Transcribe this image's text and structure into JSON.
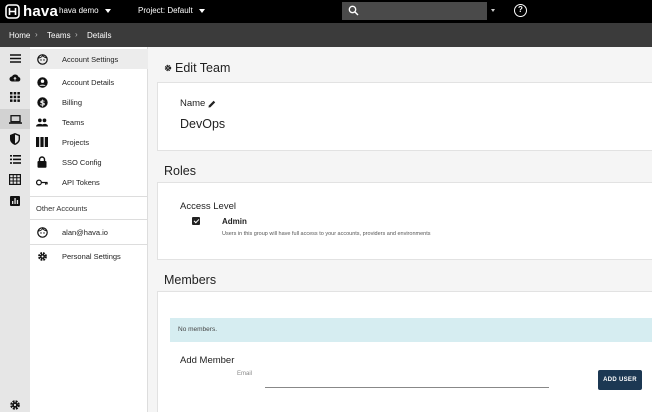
{
  "topbar": {
    "logo_text": "hava",
    "account_label": "hava demo",
    "project_label": "Project: Default",
    "search_placeholder": "",
    "help_glyph": "?"
  },
  "breadcrumb": {
    "items": [
      "Home",
      "Teams",
      "Details"
    ],
    "separator": "›"
  },
  "rail": {
    "icons": [
      "menu-icon",
      "cloud-icon",
      "grid-icon",
      "laptop-icon",
      "shield-icon",
      "list-icon",
      "table-icon",
      "chart-icon",
      "settings-icon"
    ],
    "active": "laptop-icon"
  },
  "sidebar": {
    "header": "Account Settings",
    "items": [
      {
        "label": "Account Details",
        "icon": "user-circle-icon"
      },
      {
        "label": "Billing",
        "icon": "dollar-icon"
      },
      {
        "label": "Teams",
        "icon": "people-icon"
      },
      {
        "label": "Projects",
        "icon": "columns-icon"
      },
      {
        "label": "SSO Config",
        "icon": "lock-icon"
      },
      {
        "label": "API Tokens",
        "icon": "key-icon"
      }
    ],
    "other_accounts_title": "Other Accounts",
    "other_account": "alan@hava.io",
    "personal_settings": "Personal Settings"
  },
  "main": {
    "edit_title": "Edit Team",
    "name_label": "Name",
    "team_name": "DevOps",
    "roles_title": "Roles",
    "access_level_label": "Access Level",
    "role": {
      "name": "Admin",
      "checked": true,
      "description": "Users in this group will have full access to your accounts, providers and environments"
    },
    "members_title": "Members",
    "no_members_text": "No members.",
    "add_member_title": "Add Member",
    "email_label": "Email",
    "email_value": "",
    "add_button": "ADD USER"
  },
  "colors": {
    "topbar": "#000000",
    "breadcrumb_bar": "#3b3b3b",
    "notice_bg": "#d6edf1",
    "button_bg": "#1c3853"
  }
}
